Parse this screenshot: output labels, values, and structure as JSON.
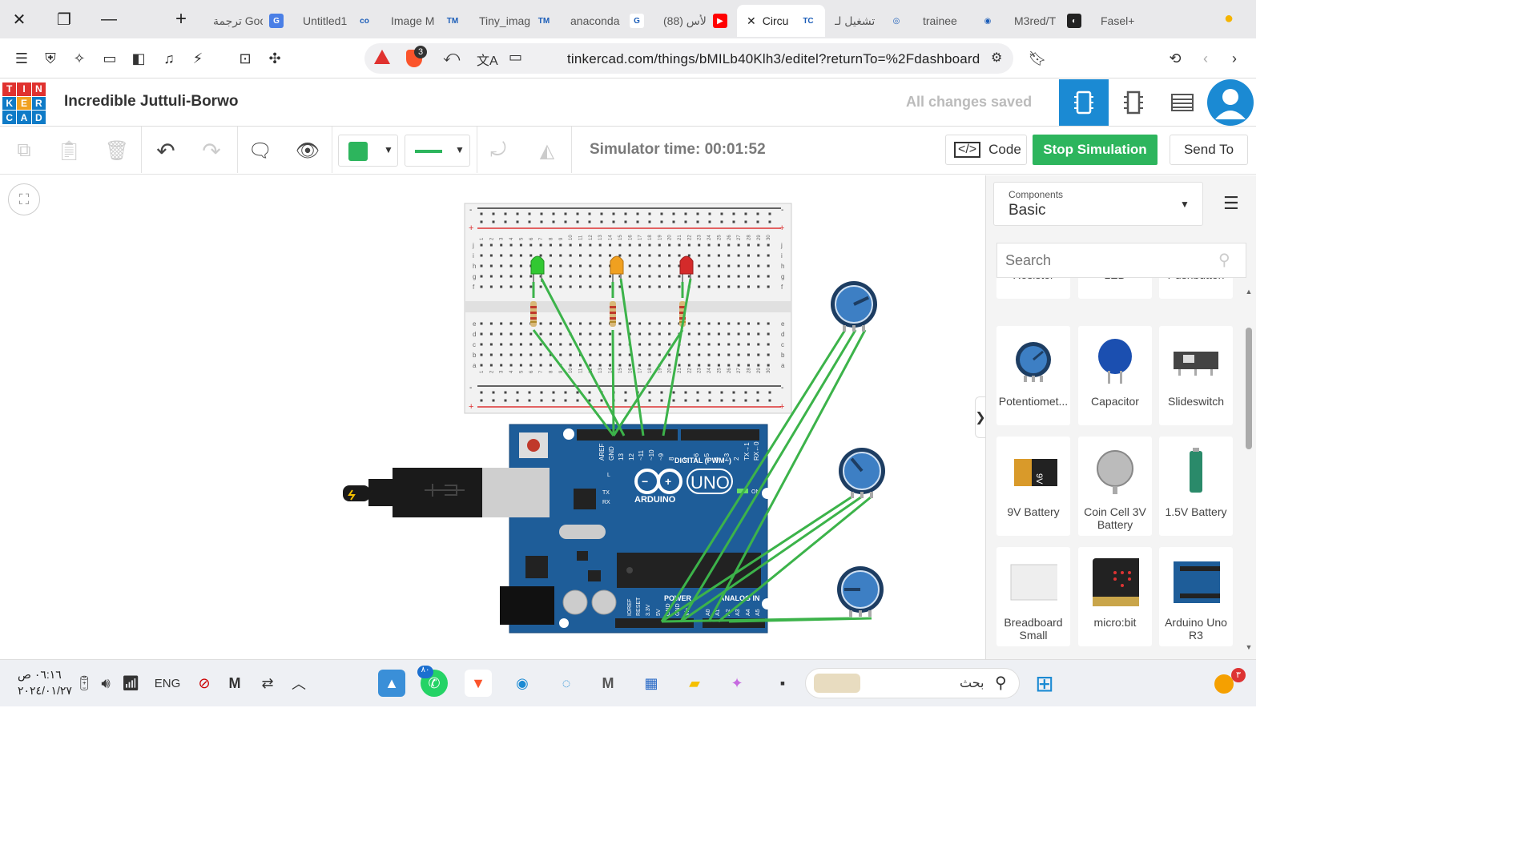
{
  "tabs": [
    {
      "label": "ترجمة Google",
      "fav_bg": "#4a7fe6",
      "fav_txt": "G"
    },
    {
      "label": "Untitled1",
      "fav_bg": "#e9e9eb",
      "fav_txt": "co"
    },
    {
      "label": "Image M",
      "fav_bg": "#e9e9eb",
      "fav_txt": "TM"
    },
    {
      "label": "Tiny_imag",
      "fav_bg": "#e9e9eb",
      "fav_txt": "TM"
    },
    {
      "label": "anaconda",
      "fav_bg": "#fff",
      "fav_txt": "G"
    },
    {
      "label": "(88) الأس",
      "fav_bg": "#ff0000",
      "fav_txt": "▶"
    },
    {
      "label": "Circu",
      "fav_bg": "#fff",
      "fav_txt": "TC",
      "active": true
    },
    {
      "label": "تشغيل لـ",
      "fav_bg": "#e9e9eb",
      "fav_txt": "◎"
    },
    {
      "label": "trainee",
      "fav_bg": "#e9e9eb",
      "fav_txt": "◉"
    },
    {
      "label": "M3red/T",
      "fav_bg": "#222",
      "fav_txt": "◐"
    },
    {
      "label": "Fasel+",
      "fav_bg": "#e9e9eb",
      "fav_txt": ""
    }
  ],
  "browser": {
    "url": "tinkercad.com/things/bMILb40Klh3/editel?returnTo=%2Fdashboard",
    "brave_badge": "3"
  },
  "app": {
    "logo_letters": [
      "T",
      "I",
      "N",
      "K",
      "E",
      "R",
      "C",
      "A",
      "D"
    ],
    "project_name": "Incredible Juttuli-Borwo",
    "save_status": "All changes saved"
  },
  "toolbar": {
    "sim_time": "Simulator time: 00:01:52",
    "code_label": "Code",
    "stop_label": "Stop Simulation",
    "send_label": "Send To",
    "wire_color": "#2db55d"
  },
  "panel": {
    "components_label": "Components",
    "category": "Basic",
    "search_placeholder": "Search",
    "partial_row": [
      "Resistor",
      "LED",
      "Pushbutton"
    ],
    "cards": [
      "Potentiomet...",
      "Capacitor",
      "Slideswitch",
      "9V Battery",
      "Coin Cell 3V Battery",
      "1.5V Battery",
      "Breadboard Small",
      "micro:bit",
      "Arduino Uno R3"
    ]
  },
  "board": {
    "brand": "ARDUINO",
    "model": "UNO",
    "digital": "DIGITAL (PWM~)",
    "power": "POWER",
    "analog": "ANALOG IN",
    "on": "ON",
    "pin_aref": "AREF",
    "pin_gnd": "GND",
    "pin_13": "13",
    "pin_12": "12",
    "pin_11": "~11",
    "pin_10": "~10",
    "pin_9": "~9",
    "pin_8": "8",
    "pin_7": "7",
    "pin_6": "~6",
    "pin_5": "~5",
    "pin_4": "4",
    "pin_3": "~3",
    "pin_2": "2",
    "pin_tx": "TX→1",
    "pin_rx": "RX←0",
    "led_l": "L",
    "led_tx": "TX",
    "led_rx": "RX",
    "pwr_ioref": "IOREF",
    "pwr_reset": "RESET",
    "pwr_33": "3.3V",
    "pwr_5": "5V",
    "pwr_gnd1": "GND",
    "pwr_gnd2": "GND",
    "pwr_vin": "Vin",
    "an_a0": "A0",
    "an_a1": "A1",
    "an_a2": "A2",
    "an_a3": "A3",
    "an_a4": "A4",
    "an_a5": "A5"
  },
  "breadboard": {
    "row_letters_top": [
      "j",
      "i",
      "h",
      "g",
      "f"
    ],
    "row_letters_bottom": [
      "e",
      "d",
      "c",
      "b",
      "a"
    ],
    "columns": [
      "1",
      "2",
      "3",
      "4",
      "5",
      "6",
      "7",
      "8",
      "9",
      "10",
      "11",
      "12",
      "13",
      "14",
      "15",
      "16",
      "17",
      "18",
      "19",
      "20",
      "21",
      "22",
      "23",
      "24",
      "25",
      "26",
      "27",
      "28",
      "29",
      "30"
    ],
    "rail_plus": "+",
    "rail_minus": "-"
  },
  "battery_label": "9V",
  "taskbar": {
    "time": "٠٦:١٦ ص",
    "date": "٢٠٢٤/٠١/٢٧",
    "lang": "ENG",
    "search": "بحث",
    "whatsapp_badge": "٨٠",
    "notif_badge": "٣"
  }
}
